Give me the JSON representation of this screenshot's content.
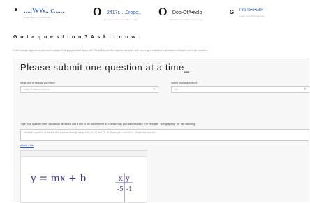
{
  "header": {
    "bullet": "•",
    "brand": "....|WW.. c......",
    "brand_sub": "Create one to our trees today",
    "stats": [
      {
        "big": "O",
        "value": "2417r.....0ropo,,",
        "sub": "Questions answered in all our topics",
        "dark": false
      },
      {
        "big": "O",
        "value": "Dop-OfA•it≤lp",
        "sub": "Members gained this week and ago",
        "dark": true
      }
    ],
    "g_label": "G",
    "next": "Pro-lb•o•u±H",
    "next_sub": "Lower a Pro Plus plan here"
  },
  "page": {
    "heading": "G o t a  q u e s t i o n ? A s k  i t  n o w .",
    "intro": "Have a tough algebra or chemical equation that you just can't figure out? Send it to us! Our experts can work with you to get a detailed explanation of how to solve the problem."
  },
  "form": {
    "title": "Please submit one question at a time_,",
    "help_label": "What kind of help do you need?",
    "help_value": "Dvar Of-aksteet Amelee",
    "grade_label": "Select your grade level:*",
    "grade_value": "sth",
    "question_label": "Type your question here. Include all directions and a hint to the tutor if there is a certain way you want it solved. For example, \"Use graphing\" or \"use factoring\".",
    "question_text": "Find the equation of the line that passes through the points (-3, -5) and (1, 3). Show your work for it. Graph the equation.",
    "attach_label": "Attach a file",
    "drawing": {
      "equation": "y = mx + b",
      "table_header": [
        "x",
        "y"
      ],
      "table_rows": [
        [
          "-5",
          "-1"
        ]
      ]
    }
  }
}
